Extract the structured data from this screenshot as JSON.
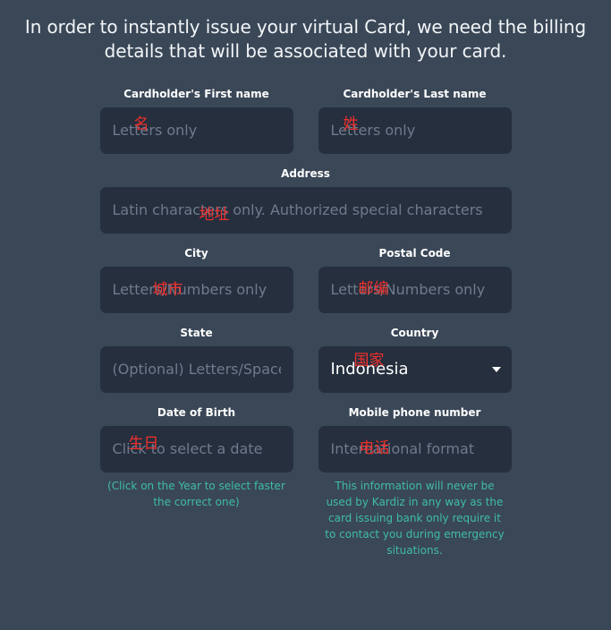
{
  "page": {
    "title": "In order to instantly issue your virtual Card, we need the billing details that will be associated with your card.",
    "background_color": "#3a4757",
    "input_color": "#252f3e",
    "annotation_color": "#f0302c",
    "helper_color": "#3fbda2"
  },
  "fields": {
    "first_name": {
      "label": "Cardholder's First name",
      "placeholder": "Letters only",
      "value": "",
      "annotation": "名"
    },
    "last_name": {
      "label": "Cardholder's Last name",
      "placeholder": "Letters only",
      "value": "",
      "annotation": "姓"
    },
    "address": {
      "label": "Address",
      "placeholder": "Latin characters only. Authorized special characters",
      "value": "",
      "annotation": "地址"
    },
    "city": {
      "label": "City",
      "placeholder": "Letters/Numbers only",
      "value": "",
      "annotation": "城市"
    },
    "postal_code": {
      "label": "Postal Code",
      "placeholder": "Letters/Numbers only",
      "value": "",
      "annotation": "邮编"
    },
    "state": {
      "label": "State",
      "placeholder": "(Optional) Letters/Spaces only",
      "value": "",
      "annotation": ""
    },
    "country": {
      "label": "Country",
      "selected": "Indonesia",
      "annotation": "国家",
      "caret_icon": "chevron-down-icon"
    },
    "date_of_birth": {
      "label": "Date of Birth",
      "placeholder": "Click to select a date",
      "value": "",
      "annotation": "生日",
      "helper": "(Click on the Year to select faster the correct one)"
    },
    "mobile_phone": {
      "label": "Mobile phone number",
      "placeholder": "International format",
      "value": "",
      "annotation": "电话",
      "helper": "This information will never be used by Kardiz in any way as the card issuing bank only require it to contact you during emergency situations."
    }
  }
}
